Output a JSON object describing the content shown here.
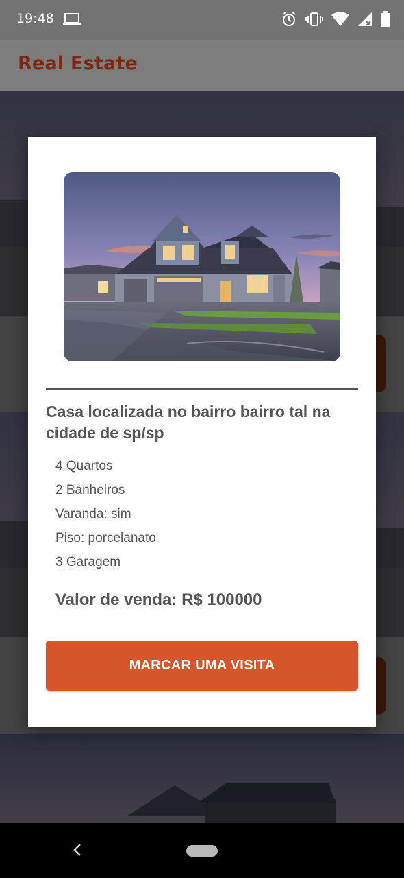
{
  "status_bar": {
    "time": "19:48",
    "icons": [
      "laptop-icon",
      "alarm-icon",
      "vibrate-icon",
      "wifi-icon",
      "signal-icon",
      "battery-icon"
    ]
  },
  "app_bar": {
    "title": "Real Estate"
  },
  "dialog": {
    "image_alt": "house-photo",
    "title": "Casa localizada no bairro bairro tal na cidade de sp/sp",
    "features": [
      "4 Quartos",
      "2 Banheiros",
      "Varanda: sim",
      "Piso: porcelanato",
      "3 Garagem"
    ],
    "price": "Valor de venda: R$ 100000",
    "cta_label": "MARCAR UMA VISITA"
  },
  "colors": {
    "accent": "#d6552a",
    "title_color": "#7a2a14",
    "text": "#555555"
  },
  "nav_bar": {
    "icons": [
      "back-icon",
      "home-pill"
    ]
  }
}
